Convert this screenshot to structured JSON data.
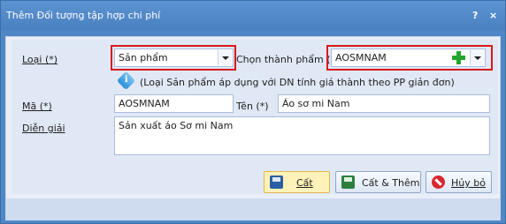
{
  "window": {
    "title": "Thêm Đối tượng tập hợp chi phí",
    "help": "?",
    "close": "×"
  },
  "form": {
    "loai": {
      "label": "Loại (*)",
      "value": "Sản phẩm"
    },
    "chon_thanh_pham": {
      "label": "Chọn thành phẩm (*)",
      "value": "AOSMNAM"
    },
    "note": "(Loại Sản phẩm áp dụng với DN tính giá thành theo PP giản đơn)",
    "ma": {
      "label": "Mã (*)",
      "value": "AOSMNAM"
    },
    "ten": {
      "label": "Tên (*)",
      "value": "Áo sơ mi Nam"
    },
    "dien_giai": {
      "label": "Diễn giải",
      "value": "Sản xuất áo Sơ mi Nam"
    }
  },
  "buttons": {
    "save": "Cất",
    "save_add": "Cất & Thêm",
    "cancel": "Hủy bỏ"
  },
  "colors": {
    "title_bar": "#4f87c6",
    "highlight_border": "#d9191f"
  }
}
